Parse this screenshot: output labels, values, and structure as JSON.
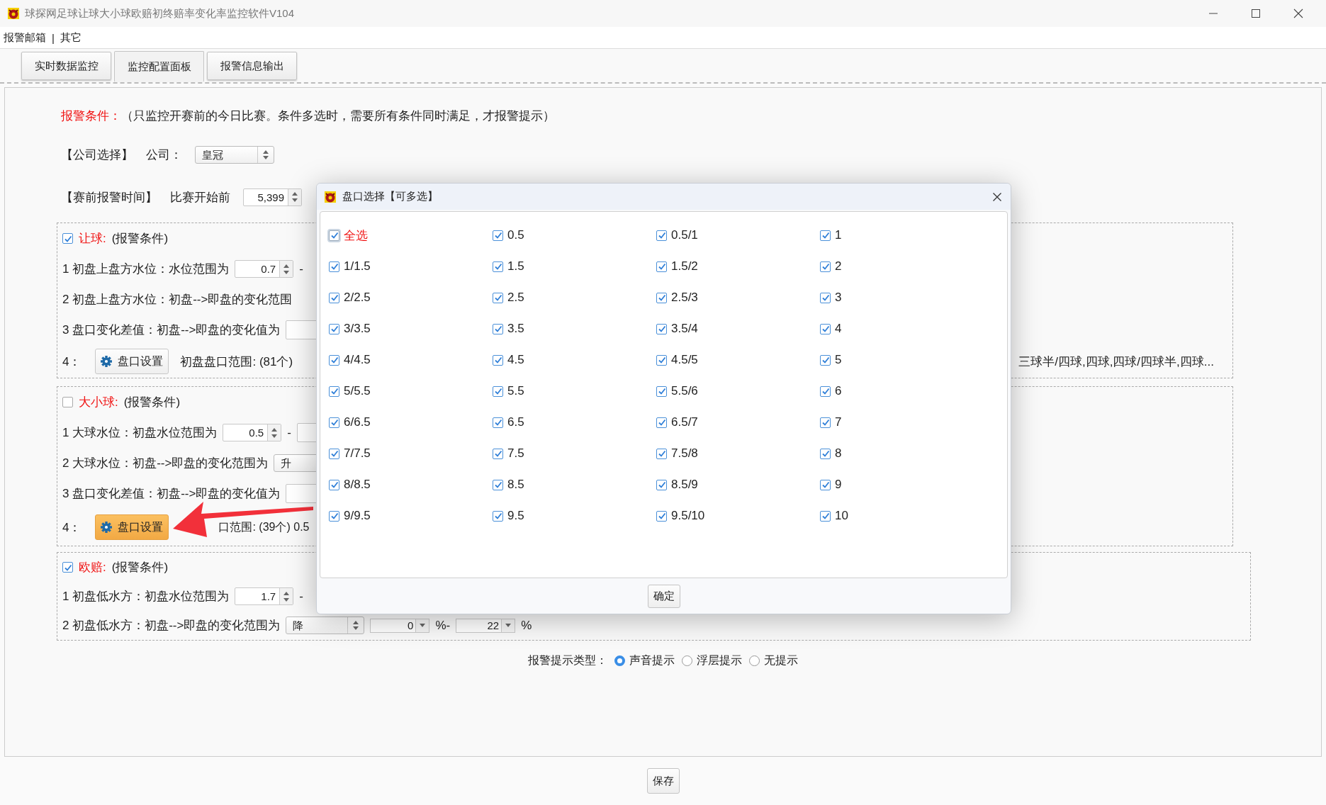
{
  "window": {
    "title": "球探网足球让球大小球欧赔初终赔率变化率监控软件V104"
  },
  "menu": {
    "items": [
      "报警邮箱",
      "其它"
    ],
    "separator": "|"
  },
  "tabs": [
    {
      "label": "实时数据监控",
      "selected": false
    },
    {
      "label": "监控配置面板",
      "selected": true
    },
    {
      "label": "报警信息输出",
      "selected": false
    }
  ],
  "heading": {
    "label": "报警条件：",
    "note": "（只监控开赛前的今日比赛。条件多选时，需要所有条件同时满足，才报警提示）"
  },
  "company": {
    "section": "【公司选择】",
    "label": "公司：",
    "value": "皇冠"
  },
  "pre_alert": {
    "section": "【赛前报警时间】",
    "label": "比赛开始前",
    "value": "5,399"
  },
  "groups": [
    {
      "title": "让球:",
      "note": "(报警条件)",
      "checked": true,
      "lines": [
        {
          "items": [
            {
              "kind": "text",
              "text": "1 初盘上盘方水位：水位范围为"
            },
            {
              "kind": "spin",
              "value": "0.7"
            },
            {
              "kind": "text",
              "text": "-"
            }
          ]
        },
        {
          "items": [
            {
              "kind": "text",
              "text": "2 初盘上盘方水位：初盘-->即盘的变化范围"
            }
          ]
        },
        {
          "items": [
            {
              "kind": "text",
              "text": "3 盘口变化差值：初盘-->即盘的变化值为"
            },
            {
              "kind": "field"
            }
          ]
        },
        {
          "items": [
            {
              "kind": "text",
              "text": "4："
            },
            {
              "kind": "button",
              "label": "盘口设置",
              "highlighted": false
            },
            {
              "kind": "text",
              "text": "初盘盘口范围: (81个)"
            },
            {
              "kind": "tail",
              "text": "三球半/四球,四球,四球/四球半,四球..."
            }
          ]
        }
      ]
    },
    {
      "title": "大小球:",
      "note": "(报警条件)",
      "checked": false,
      "lines": [
        {
          "items": [
            {
              "kind": "text",
              "text": "1 大球水位：初盘水位范围为"
            },
            {
              "kind": "spin",
              "value": "0.5"
            },
            {
              "kind": "text",
              "text": "-"
            },
            {
              "kind": "field"
            }
          ]
        },
        {
          "items": [
            {
              "kind": "text",
              "text": "2  大球水位：初盘-->即盘的变化范围为"
            },
            {
              "kind": "select",
              "value": "升"
            }
          ]
        },
        {
          "items": [
            {
              "kind": "text",
              "text": "3 盘口变化差值：初盘-->即盘的变化值为"
            },
            {
              "kind": "field"
            }
          ]
        },
        {
          "items": [
            {
              "kind": "text",
              "text": "4："
            },
            {
              "kind": "button",
              "label": "盘口设置",
              "highlighted": true
            },
            {
              "kind": "partial",
              "text": "口范围: (39个) 0.5"
            }
          ]
        }
      ]
    },
    {
      "title": "欧赔:",
      "note": "(报警条件)",
      "checked": true,
      "lines": [
        {
          "items": [
            {
              "kind": "text",
              "text": "1 初盘低水方：初盘水位范围为"
            },
            {
              "kind": "spin",
              "value": "1.7"
            },
            {
              "kind": "text",
              "text": "-"
            }
          ]
        },
        {
          "items": [
            {
              "kind": "text",
              "text": "2 初盘低水方：初盘-->即盘的变化范围为"
            },
            {
              "kind": "select",
              "value": "降"
            },
            {
              "kind": "combo",
              "value": "0"
            },
            {
              "kind": "text",
              "text": "%-"
            },
            {
              "kind": "combo",
              "value": "22"
            },
            {
              "kind": "text",
              "text": "%"
            }
          ]
        }
      ]
    }
  ],
  "alert": {
    "label": "报警提示类型：",
    "options": [
      {
        "label": "声音提示",
        "selected": true
      },
      {
        "label": "浮层提示",
        "selected": false
      },
      {
        "label": "无提示",
        "selected": false
      }
    ]
  },
  "save_button": "保存",
  "dialog": {
    "title": "盘口选择【可多选】",
    "ok_button": "确定",
    "items": [
      {
        "label": "全选",
        "kind": "all",
        "checked": true
      },
      {
        "label": "0.5",
        "kind": "line",
        "checked": true
      },
      {
        "label": "0.5/1",
        "kind": "line",
        "checked": true
      },
      {
        "label": "1",
        "kind": "line",
        "checked": true
      },
      {
        "label": "1/1.5",
        "kind": "line",
        "checked": true
      },
      {
        "label": "1.5",
        "kind": "line",
        "checked": true
      },
      {
        "label": "1.5/2",
        "kind": "line",
        "checked": true
      },
      {
        "label": "2",
        "kind": "line",
        "checked": true
      },
      {
        "label": "2/2.5",
        "kind": "line",
        "checked": true
      },
      {
        "label": "2.5",
        "kind": "line",
        "checked": true
      },
      {
        "label": "2.5/3",
        "kind": "line",
        "checked": true
      },
      {
        "label": "3",
        "kind": "line",
        "checked": true
      },
      {
        "label": "3/3.5",
        "kind": "line",
        "checked": true
      },
      {
        "label": "3.5",
        "kind": "line",
        "checked": true
      },
      {
        "label": "3.5/4",
        "kind": "line",
        "checked": true
      },
      {
        "label": "4",
        "kind": "line",
        "checked": true
      },
      {
        "label": "4/4.5",
        "kind": "line",
        "checked": true
      },
      {
        "label": "4.5",
        "kind": "line",
        "checked": true
      },
      {
        "label": "4.5/5",
        "kind": "line",
        "checked": true
      },
      {
        "label": "5",
        "kind": "line",
        "checked": true
      },
      {
        "label": "5/5.5",
        "kind": "line",
        "checked": true
      },
      {
        "label": "5.5",
        "kind": "line",
        "checked": true
      },
      {
        "label": "5.5/6",
        "kind": "line",
        "checked": true
      },
      {
        "label": "6",
        "kind": "line",
        "checked": true
      },
      {
        "label": "6/6.5",
        "kind": "line",
        "checked": true
      },
      {
        "label": "6.5",
        "kind": "line",
        "checked": true
      },
      {
        "label": "6.5/7",
        "kind": "line",
        "checked": true
      },
      {
        "label": "7",
        "kind": "line",
        "checked": true
      },
      {
        "label": "7/7.5",
        "kind": "line",
        "checked": true
      },
      {
        "label": "7.5",
        "kind": "line",
        "checked": true
      },
      {
        "label": "7.5/8",
        "kind": "line",
        "checked": true
      },
      {
        "label": "8",
        "kind": "line",
        "checked": true
      },
      {
        "label": "8/8.5",
        "kind": "line",
        "checked": true
      },
      {
        "label": "8.5",
        "kind": "line",
        "checked": true
      },
      {
        "label": "8.5/9",
        "kind": "line",
        "checked": true
      },
      {
        "label": "9",
        "kind": "line",
        "checked": true
      },
      {
        "label": "9/9.5",
        "kind": "line",
        "checked": true
      },
      {
        "label": "9.5",
        "kind": "line",
        "checked": true
      },
      {
        "label": "9.5/10",
        "kind": "line",
        "checked": true
      },
      {
        "label": "10",
        "kind": "line",
        "checked": true
      }
    ]
  }
}
